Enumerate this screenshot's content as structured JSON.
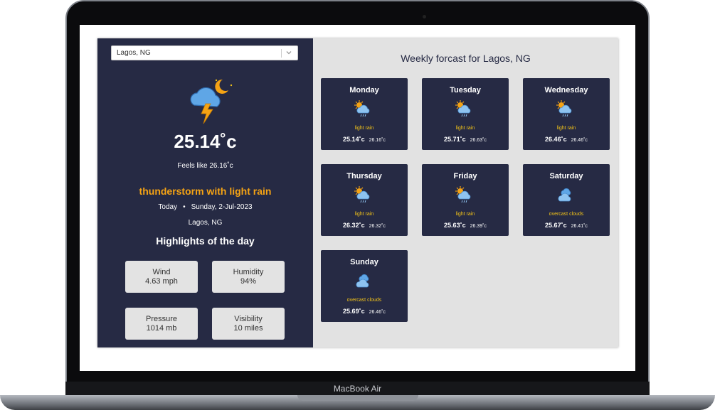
{
  "device": {
    "brand": "MacBook Air"
  },
  "location_select": {
    "value": "Lagos, NG"
  },
  "current": {
    "temperature": "25.14˚c",
    "feels_like": "Feels like 26.16˚c",
    "description": "thunderstorm with light rain",
    "day_label": "Today",
    "date": "Sunday, 2-Jul-2023",
    "separator": "•",
    "city": "Lagos, NG",
    "icon": "thunderstorm-night-icon"
  },
  "highlights": {
    "title": "Highlights of the day",
    "items": [
      {
        "label": "Wind",
        "value": "4.63 mph"
      },
      {
        "label": "Humidity",
        "value": "94%"
      },
      {
        "label": "Pressure",
        "value": "1014 mb"
      },
      {
        "label": "Visibility",
        "value": "10 miles"
      }
    ]
  },
  "weekly": {
    "title": "Weekly forcast for Lagos, NG",
    "days": [
      {
        "name": "Monday",
        "description": "light rain",
        "temp": "25.14˚c",
        "feels": "26.16˚c",
        "icon": "sun-rain-cloud-icon"
      },
      {
        "name": "Tuesday",
        "description": "light rain",
        "temp": "25.71˚c",
        "feels": "26.63˚c",
        "icon": "sun-rain-cloud-icon"
      },
      {
        "name": "Wednesday",
        "description": "light rain",
        "temp": "26.46˚c",
        "feels": "26.46˚c",
        "icon": "sun-rain-cloud-icon"
      },
      {
        "name": "Thursday",
        "description": "light rain",
        "temp": "26.32˚c",
        "feels": "26.32˚c",
        "icon": "sun-rain-cloud-icon"
      },
      {
        "name": "Friday",
        "description": "light rain",
        "temp": "25.63˚c",
        "feels": "26.39˚c",
        "icon": "sun-rain-cloud-icon"
      },
      {
        "name": "Saturday",
        "description": "overcast clouds",
        "temp": "25.67˚c",
        "feels": "26.41˚c",
        "icon": "overcast-clouds-icon"
      },
      {
        "name": "Sunday",
        "description": "overcast clouds",
        "temp": "25.69˚c",
        "feels": "26.46˚c",
        "icon": "overcast-clouds-icon"
      }
    ]
  },
  "colors": {
    "panel": "#262a44",
    "accent": "#f5a314",
    "forecast_bg": "#e2e2e2"
  }
}
